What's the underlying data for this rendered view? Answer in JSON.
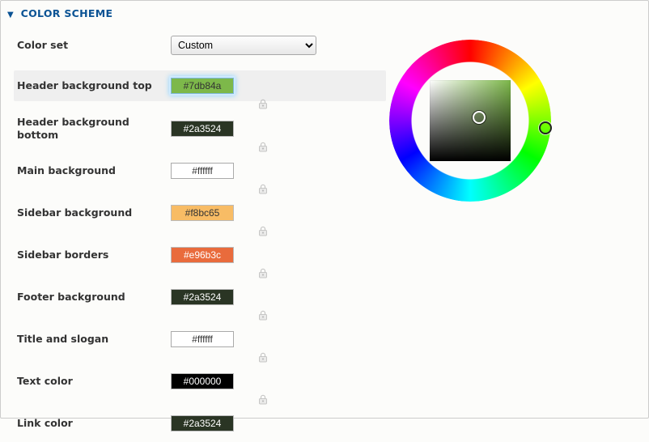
{
  "header": {
    "title": "COLOR SCHEME"
  },
  "colorset": {
    "label": "Color set",
    "value": "Custom"
  },
  "rows": {
    "header_bg_top": {
      "label": "Header background top",
      "value": "#7db84a",
      "text": "#333"
    },
    "header_bg_bottom": {
      "label": "Header background bottom",
      "value": "#2a3524",
      "text": "#fff"
    },
    "main_bg": {
      "label": "Main background",
      "value": "#ffffff",
      "text": "#333"
    },
    "sidebar_bg": {
      "label": "Sidebar background",
      "value": "#f8bc65",
      "text": "#333"
    },
    "sidebar_borders": {
      "label": "Sidebar borders",
      "value": "#e96b3c",
      "text": "#fff"
    },
    "footer_bg": {
      "label": "Footer background",
      "value": "#2a3524",
      "text": "#fff"
    },
    "title_slogan": {
      "label": "Title and slogan",
      "value": "#ffffff",
      "text": "#333"
    },
    "text_color": {
      "label": "Text color",
      "value": "#000000",
      "text": "#fff"
    },
    "link_color": {
      "label": "Link color",
      "value": "#2a3524",
      "text": "#fff"
    }
  },
  "selected_row": "header_bg_top",
  "row_order": [
    "header_bg_top",
    "header_bg_bottom",
    "main_bg",
    "sidebar_bg",
    "sidebar_borders",
    "footer_bg",
    "title_slogan",
    "text_color",
    "link_color"
  ],
  "lock": {
    "tooltip": "lock-icon"
  }
}
